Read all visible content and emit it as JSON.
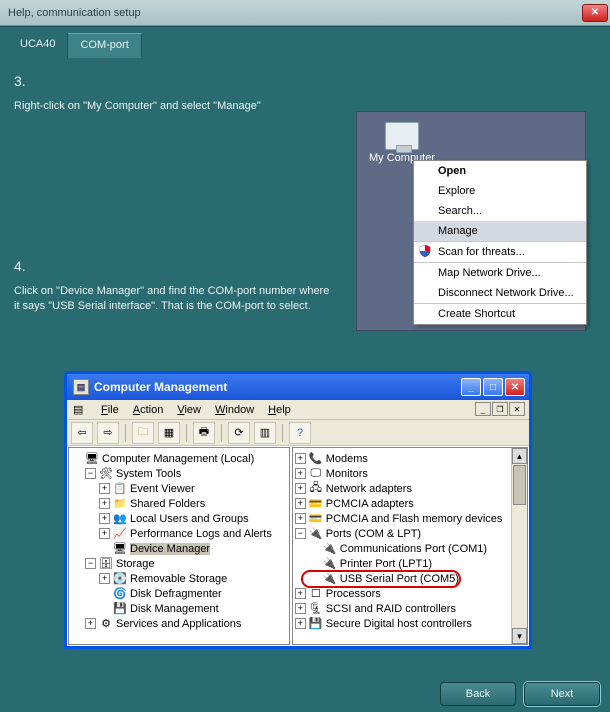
{
  "titlebar": {
    "title": "Help, communication setup"
  },
  "tabs": {
    "uca40": "UCA40",
    "comport": "COM-port"
  },
  "step3": {
    "num": "3.",
    "text": "Right-click on \"My Computer\" and select \"Manage\""
  },
  "step4": {
    "num": "4.",
    "text": "Click on \"Device Manager\" and find the COM-port number where it says \"USB Serial interface\". That is the COM-port to select."
  },
  "desktop": {
    "mycomputer_label": "My Computer",
    "menu": {
      "open": "Open",
      "explore": "Explore",
      "search": "Search...",
      "manage": "Manage",
      "scan": "Scan for threats...",
      "mapdrive": "Map Network Drive...",
      "disconnect": "Disconnect Network Drive...",
      "shortcut": "Create Shortcut"
    }
  },
  "cm": {
    "title": "Computer Management",
    "menu": {
      "file": "File",
      "action": "Action",
      "view": "View",
      "window": "Window",
      "help": "Help"
    },
    "left": {
      "root": "Computer Management (Local)",
      "systools": "System Tools",
      "eventviewer": "Event Viewer",
      "shared": "Shared Folders",
      "users": "Local Users and Groups",
      "perf": "Performance Logs and Alerts",
      "devmgr": "Device Manager",
      "storage": "Storage",
      "removable": "Removable Storage",
      "defrag": "Disk Defragmenter",
      "diskmgmt": "Disk Management",
      "services": "Services and Applications"
    },
    "right": {
      "modems": "Modems",
      "monitors": "Monitors",
      "netadapters": "Network adapters",
      "pcmcia": "PCMCIA adapters",
      "pcmciaflash": "PCMCIA and Flash memory devices",
      "ports": "Ports (COM & LPT)",
      "com1": "Communications Port (COM1)",
      "lpt1": "Printer Port (LPT1)",
      "usbserial": "USB Serial Port (COM5)",
      "processors": "Processors",
      "scsi": "SCSI and RAID controllers",
      "sdhost": "Secure Digital host controllers"
    }
  },
  "buttons": {
    "back": "Back",
    "next": "Next"
  }
}
